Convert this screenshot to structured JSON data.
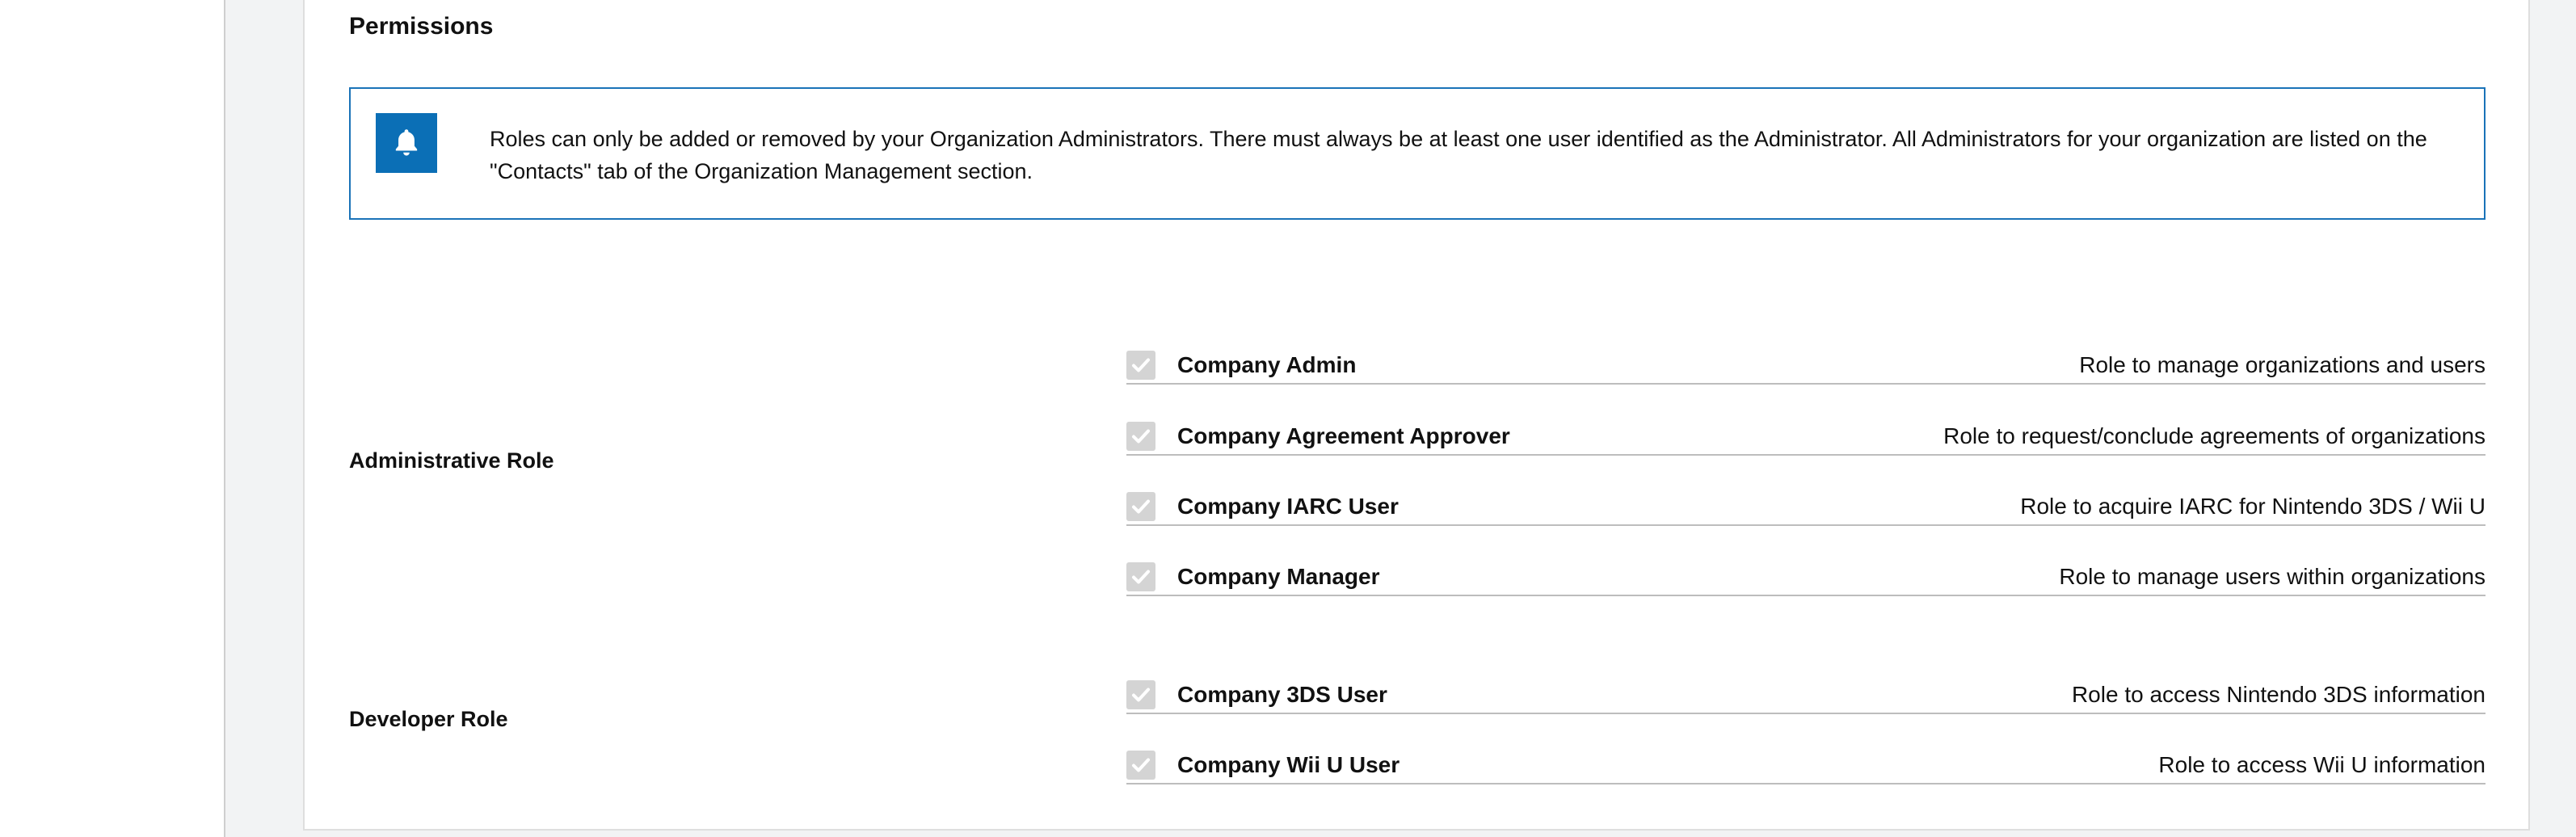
{
  "permissions": {
    "title": "Permissions",
    "notice": {
      "icon": "bell-icon",
      "text": "Roles can only be added or removed by your Organization Administrators. There must always be at least one user identified as the Administrator. All Administrators for your organization are listed on the \"Contacts\" tab of the Organization Management section."
    },
    "administrative_role": {
      "label": "Administrative Role",
      "roles": [
        {
          "name": "Company Admin",
          "description": "Role to manage organizations and users",
          "checked": true
        },
        {
          "name": "Company Agreement Approver",
          "description": "Role to request/conclude agreements of organizations",
          "checked": true
        },
        {
          "name": "Company IARC User",
          "description": "Role to acquire IARC for Nintendo 3DS / Wii U",
          "checked": true
        },
        {
          "name": "Company Manager",
          "description": "Role to manage users within organizations",
          "checked": true
        }
      ]
    },
    "developer_role": {
      "label": "Developer Role",
      "roles": [
        {
          "name": "Company 3DS User",
          "description": "Role to access Nintendo 3DS information",
          "checked": true
        },
        {
          "name": "Company Wii U User",
          "description": "Role to access Wii U information",
          "checked": true
        }
      ]
    }
  },
  "colors": {
    "accent": "#0b6fb6",
    "notice_border": "#1a73b8",
    "checkbox_disabled": "#d4d4d4",
    "row_divider": "#bdbdbd",
    "page_background": "#f2f3f4"
  }
}
